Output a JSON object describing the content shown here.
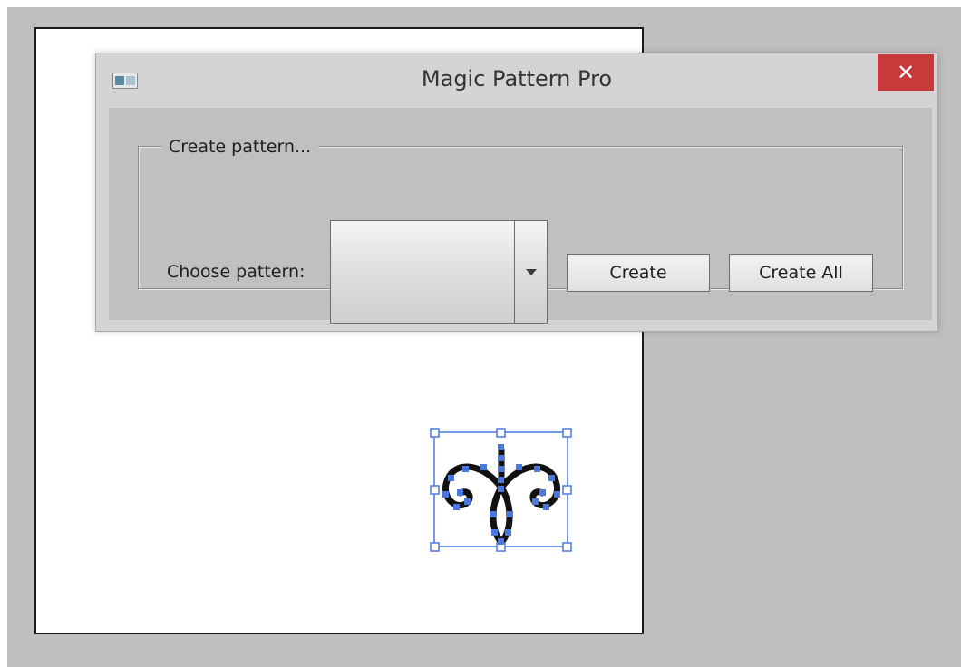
{
  "window": {
    "title": "Magic Pattern Pro",
    "close_label": "✕"
  },
  "group": {
    "legend": "Create pattern..."
  },
  "form": {
    "choose_label": "Choose pattern:",
    "selected_pattern": ""
  },
  "buttons": {
    "create": "Create",
    "create_all": "Create All"
  },
  "icons": {
    "app": "window-icon",
    "close": "close-icon",
    "dropdown": "chevron-down-icon",
    "artwork": "ornament-artwork"
  },
  "colors": {
    "close_button": "#c9383b",
    "selection": "#4a78e0",
    "pasteboard": "#bfbfbf",
    "dialog_client": "#c0c0c0"
  }
}
